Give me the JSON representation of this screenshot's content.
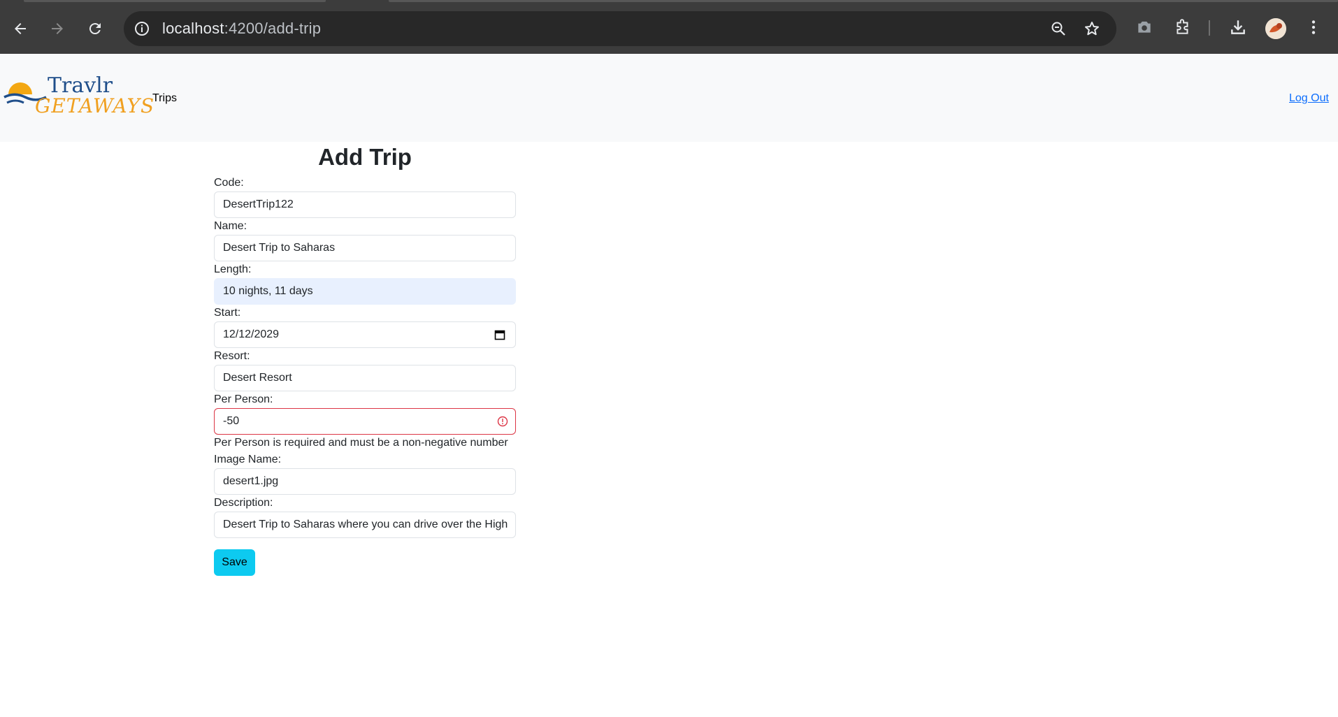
{
  "browser": {
    "url_host": "localhost",
    "url_rest": ":4200/add-trip",
    "back_icon": "arrow-left-icon",
    "forward_icon": "arrow-right-icon",
    "reload_icon": "reload-icon",
    "site_info_icon": "info-icon",
    "zoom_icon": "zoom-icon",
    "bookmark_icon": "star-icon",
    "camera_icon": "camera-icon",
    "extensions_icon": "puzzle-icon",
    "download_icon": "download-icon",
    "menu_icon": "kebab-menu-icon"
  },
  "nav": {
    "logo_top": "Travlr",
    "logo_bottom": "GETAWAYS",
    "trips": "Trips",
    "logout": "Log Out"
  },
  "form": {
    "title": "Add Trip",
    "code_label": "Code:",
    "code_value": "DesertTrip122",
    "name_label": "Name:",
    "name_value": "Desert Trip to Saharas",
    "length_label": "Length:",
    "length_value": "10 nights, 11 days",
    "start_label": "Start:",
    "start_value": "12/12/2029",
    "resort_label": "Resort:",
    "resort_value": "Desert Resort",
    "perperson_label": "Per Person:",
    "perperson_value": "-50",
    "perperson_error": "Per Person is required and must be a non-negative number",
    "image_label": "Image Name:",
    "image_value": "desert1.jpg",
    "description_label": "Description:",
    "description_value": "Desert Trip to Saharas where you can drive over the High",
    "save_label": "Save"
  },
  "colors": {
    "save_button": "#0dcaf0",
    "error_border": "#dc3545",
    "autofill_bg": "#e8f0fe",
    "link": "#0d6efd"
  }
}
